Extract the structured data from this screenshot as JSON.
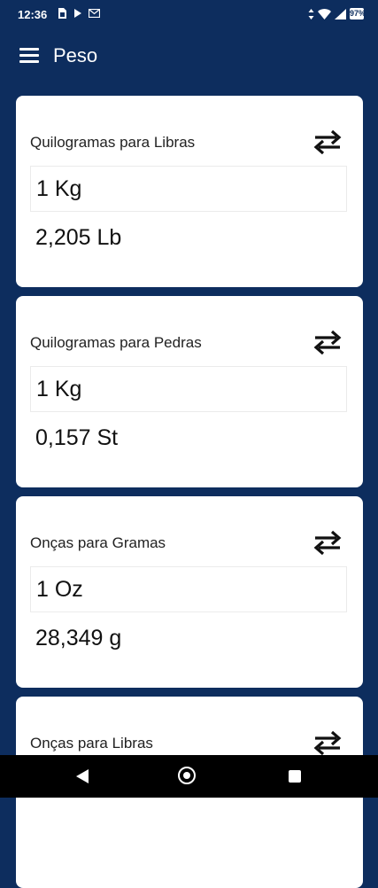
{
  "status_bar": {
    "time": "12:36",
    "battery_percent": "97%"
  },
  "app_bar": {
    "title": "Peso"
  },
  "cards": [
    {
      "title": "Quilogramas para Libras",
      "input_value": "1 Kg",
      "result": "2,205 Lb"
    },
    {
      "title": "Quilogramas para Pedras",
      "input_value": "1 Kg",
      "result": "0,157 St"
    },
    {
      "title": "Onças para Gramas",
      "input_value": "1 Oz",
      "result": "28,349 g"
    },
    {
      "title": "Onças para Libras",
      "input_value": "",
      "result": ""
    }
  ],
  "colors": {
    "background": "#0d2d5e",
    "card": "#ffffff",
    "text": "#111111"
  }
}
